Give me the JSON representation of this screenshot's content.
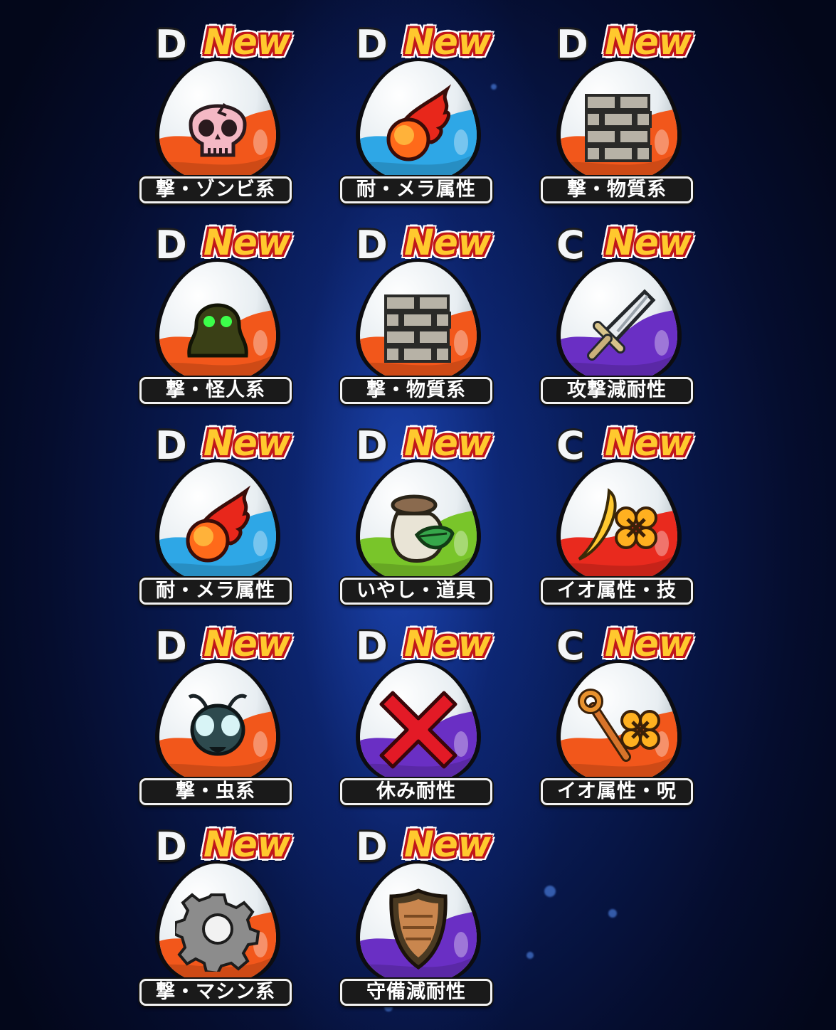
{
  "orbs": [
    {
      "grade": "D",
      "badge": "New",
      "label": "撃・ゾンビ系",
      "color": "#f2571b",
      "icon": "skull-icon"
    },
    {
      "grade": "D",
      "badge": "New",
      "label": "耐・メラ属性",
      "color": "#2ea7e6",
      "icon": "fireball-icon"
    },
    {
      "grade": "D",
      "badge": "New",
      "label": "撃・物質系",
      "color": "#f2571b",
      "icon": "brick-wall-icon"
    },
    {
      "grade": "D",
      "badge": "New",
      "label": "撃・怪人系",
      "color": "#f2571b",
      "icon": "ghost-icon"
    },
    {
      "grade": "D",
      "badge": "New",
      "label": "撃・物質系",
      "color": "#f2571b",
      "icon": "brick-wall-icon"
    },
    {
      "grade": "C",
      "badge": "New",
      "label": "攻撃減耐性",
      "color": "#6a2fc4",
      "icon": "sword-icon"
    },
    {
      "grade": "D",
      "badge": "New",
      "label": "耐・メラ属性",
      "color": "#2ea7e6",
      "icon": "fireball-icon"
    },
    {
      "grade": "D",
      "badge": "New",
      "label": "いやし・道具",
      "color": "#79c52a",
      "icon": "herb-bag-icon"
    },
    {
      "grade": "C",
      "badge": "New",
      "label": "イオ属性・技",
      "color": "#e92a1e",
      "icon": "boomerang-clover-icon"
    },
    {
      "grade": "D",
      "badge": "New",
      "label": "撃・虫系",
      "color": "#f2571b",
      "icon": "insect-icon"
    },
    {
      "grade": "D",
      "badge": "New",
      "label": "休み耐性",
      "color": "#6a2fc4",
      "icon": "x-mark-icon"
    },
    {
      "grade": "C",
      "badge": "New",
      "label": "イオ属性・呪",
      "color": "#f2571b",
      "icon": "staff-clover-icon"
    },
    {
      "grade": "D",
      "badge": "New",
      "label": "撃・マシン系",
      "color": "#f2571b",
      "icon": "gear-icon"
    },
    {
      "grade": "D",
      "badge": "New",
      "label": "守備減耐性",
      "color": "#6a2fc4",
      "icon": "shield-icon"
    }
  ]
}
